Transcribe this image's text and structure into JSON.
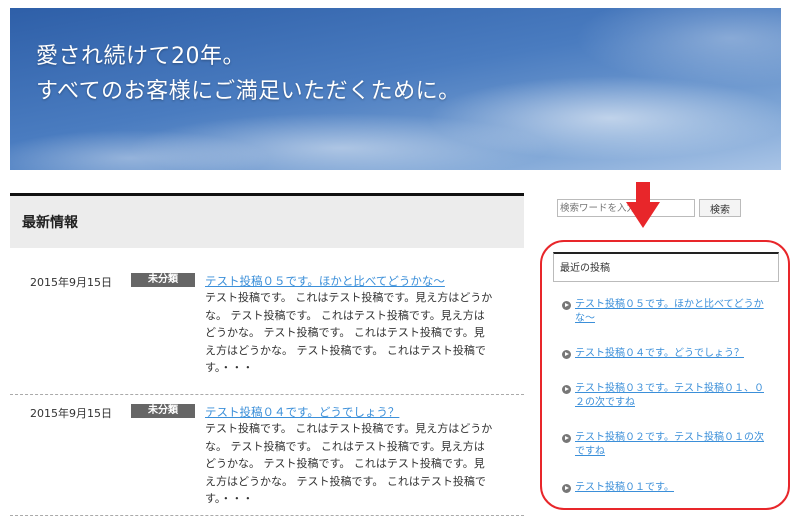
{
  "hero": {
    "line1": "愛され続けて20年。",
    "line2": "すべてのお客様にご満足いただくために。"
  },
  "main": {
    "section_title": "最新情報",
    "posts": [
      {
        "date": "2015年9月15日",
        "category": "未分類",
        "title": "テスト投稿０５です。ほかと比べてどうかな〜",
        "excerpt_lines": [
          "テスト投稿です。 これはテスト投稿です。見え方はどうか",
          "な。 テスト投稿です。 これはテスト投稿です。見え方は",
          "どうかな。 テスト投稿です。 これはテスト投稿です。見",
          "え方はどうかな。 テスト投稿です。 これはテスト投稿で",
          "す。・・・"
        ]
      },
      {
        "date": "2015年9月15日",
        "category": "未分類",
        "title": "テスト投稿０４です。どうでしょう？",
        "excerpt_lines": [
          "テスト投稿です。 これはテスト投稿です。見え方はどうか",
          "な。 テスト投稿です。 これはテスト投稿です。見え方は",
          "どうかな。 テスト投稿です。 これはテスト投稿です。見",
          "え方はどうかな。 テスト投稿です。 これはテスト投稿で",
          "す。・・・"
        ]
      }
    ]
  },
  "search": {
    "placeholder": "検索ワードを入力",
    "button_label": "検索"
  },
  "sidebar": {
    "recent_title": "最近の投稿",
    "recent_posts": [
      {
        "line1": "テスト投稿０５です。ほかと比べてどうか",
        "line2": "な〜"
      },
      {
        "line1": "テスト投稿０４です。どうでしょう？",
        "line2": ""
      },
      {
        "line1": "テスト投稿０３です。テスト投稿０１、０",
        "line2": "２の次ですね"
      },
      {
        "line1": "テスト投稿０２です。テスト投稿０１の次",
        "line2": "ですね"
      },
      {
        "line1": "テスト投稿０１です。",
        "line2": ""
      }
    ]
  },
  "annotation": {
    "highlight_color": "#e8262a"
  }
}
